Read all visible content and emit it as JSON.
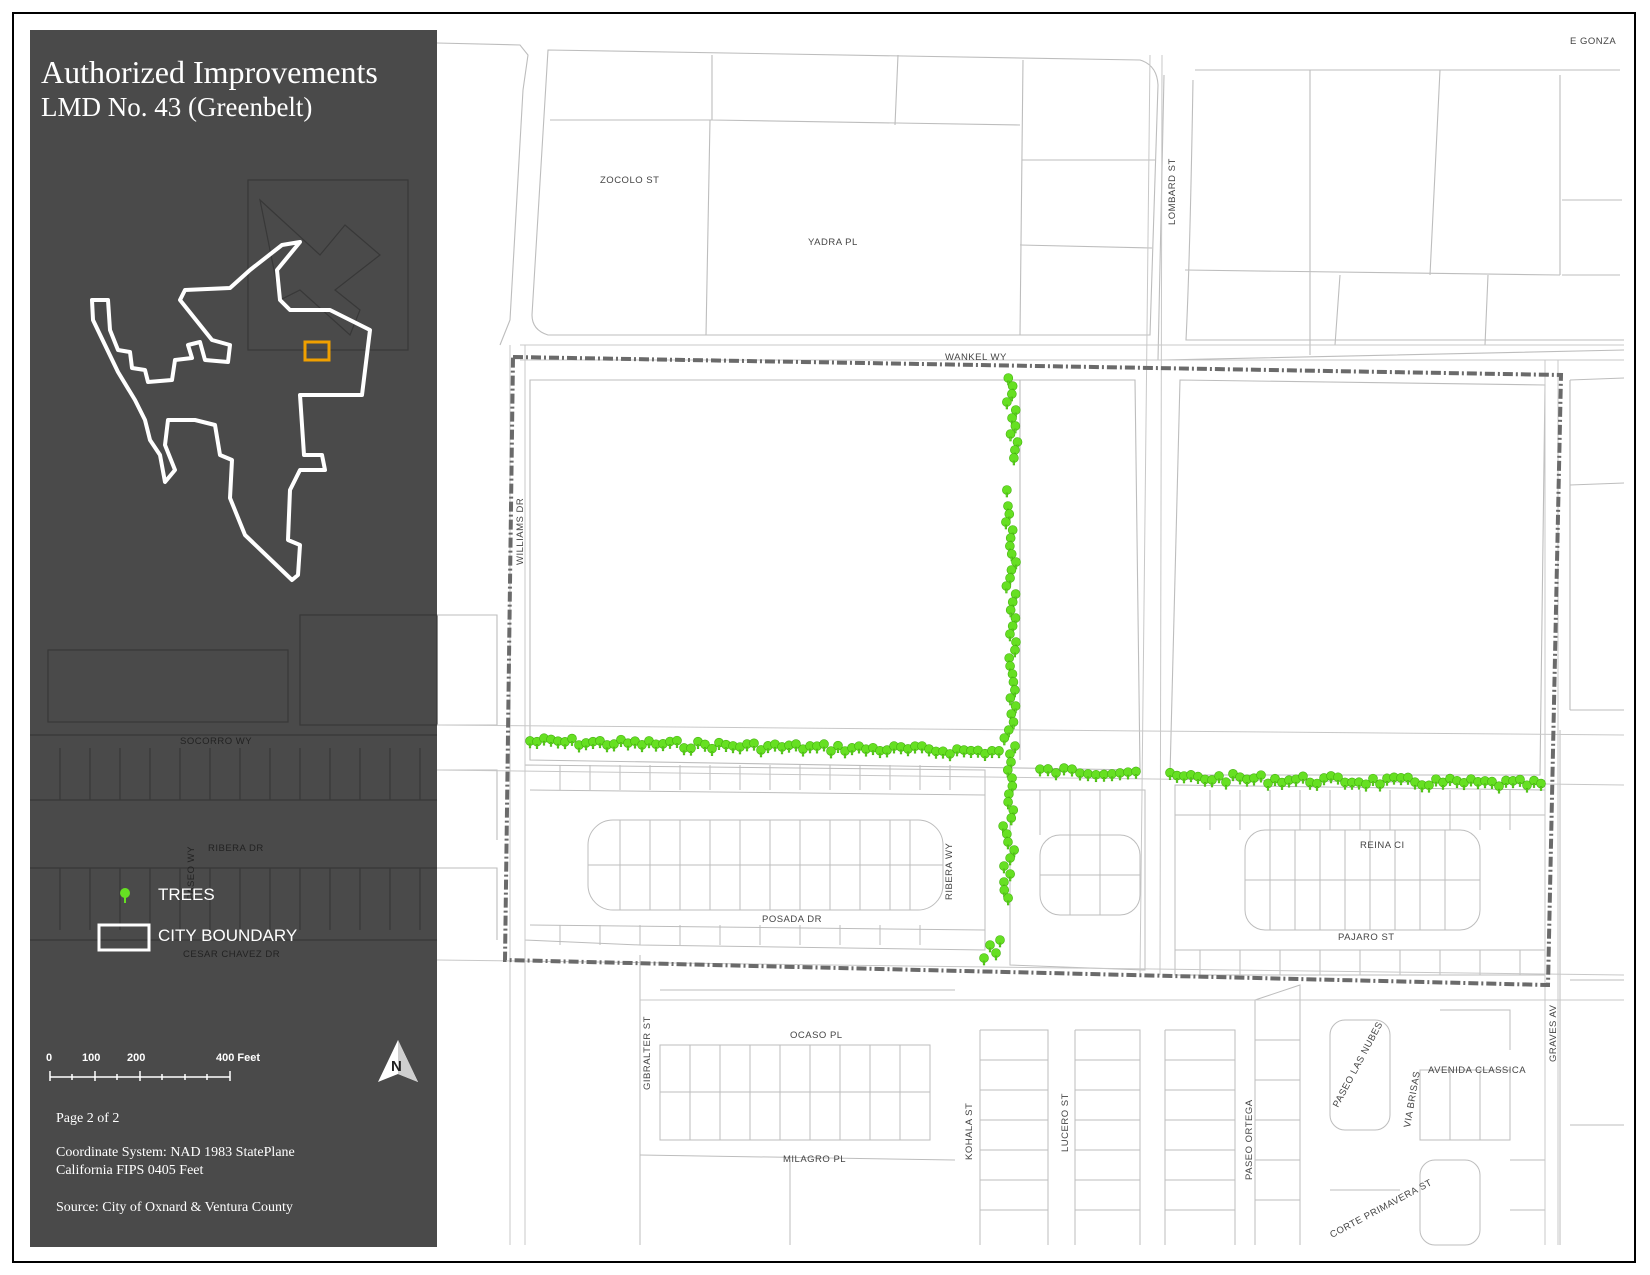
{
  "title": {
    "line1": "Authorized Improvements",
    "line2": "LMD No. 43 (Greenbelt)"
  },
  "legend": {
    "trees_label": "TREES",
    "boundary_label": "CITY BOUNDARY",
    "tree_icon": "tree-icon",
    "colors": {
      "trees": "#66e022",
      "boundary": "#ffffff",
      "locator_box": "#f0a000",
      "panel": "#4a4a4a",
      "district_boundary": "#666666"
    }
  },
  "scale_bar": {
    "ticks": [
      "0",
      "100",
      "200",
      "400 Feet"
    ]
  },
  "north_arrow": {
    "label": "N"
  },
  "info": {
    "page": "Page 2 of 2",
    "coord_line1": "Coordinate System: NAD 1983 StatePlane",
    "coord_line2": "California FIPS 0405 Feet",
    "source": "Source: City of Oxnard & Ventura County"
  },
  "streets": {
    "e_gonza": "E GONZA",
    "zocolo": "ZOCOLO ST",
    "yadra": "YADRA PL",
    "lombard": "LOMBARD ST",
    "wankel": "WANKEL WY",
    "williams": "WILLIAMS DR",
    "socorro": "SOCORRO WY",
    "ribera_dr": "RIBERA DR",
    "paseo_wy": "PASEO WY",
    "cesar_chavez": "CESAR CHAVEZ DR",
    "ribera_wy": "RIBERA WY",
    "posada": "POSADA DR",
    "reina": "REINA CI",
    "pajaro": "PAJARO ST",
    "gibralter": "GIBRALTER ST",
    "ocaso": "OCASO PL",
    "kohala": "KOHALA ST",
    "lucero": "LUCERO ST",
    "paseo_ortega": "PASEO ORTEGA",
    "paseo_las_nubes": "PASEO LAS NUBES",
    "via_brisas": "VIA BRISAS",
    "avenida_classica": "AVENIDA CLASSICA",
    "graves": "GRAVES AV",
    "milagro": "MILAGRO PL",
    "corte_primavera": "CORTE PRIMAVERA ST"
  }
}
